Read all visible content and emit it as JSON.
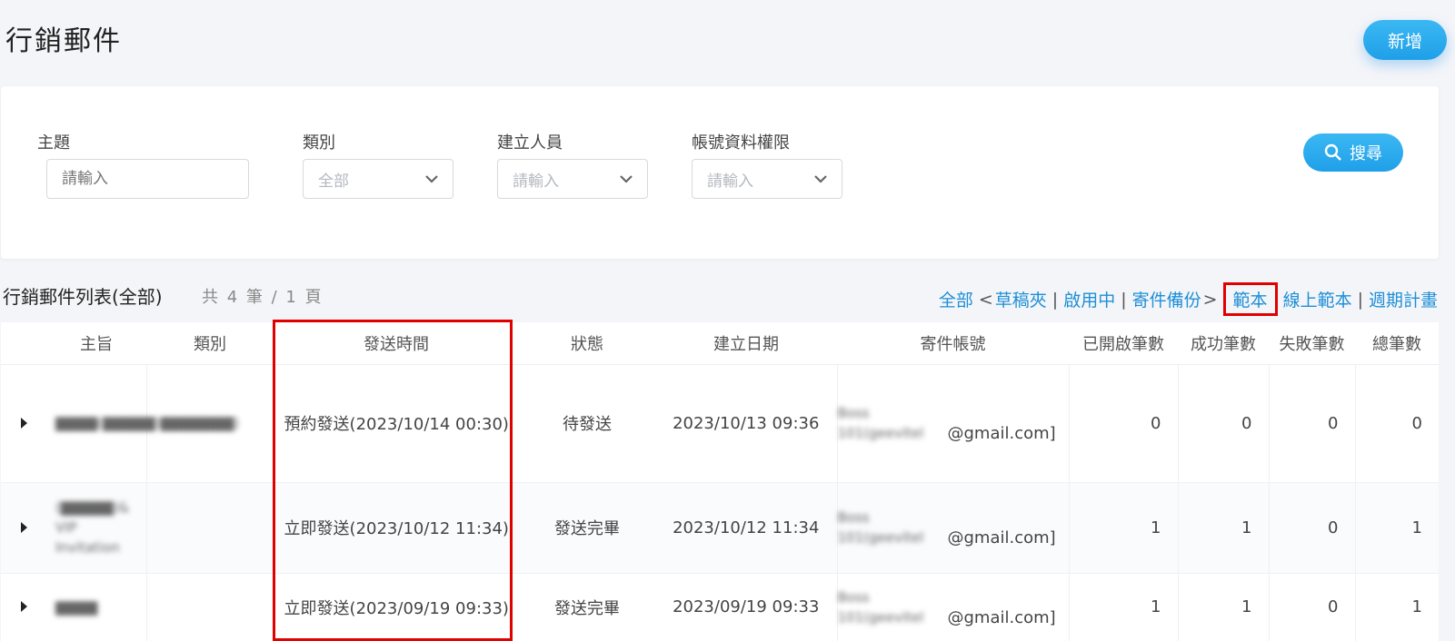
{
  "page": {
    "title": "行銷郵件",
    "add_label": "新增"
  },
  "filters": {
    "subject": {
      "label": "主題",
      "placeholder": "請輸入"
    },
    "category": {
      "label": "類別",
      "value": "全部"
    },
    "creator": {
      "label": "建立人員",
      "value": "請輸入"
    },
    "permission": {
      "label": "帳號資料權限",
      "value": "請輸入"
    },
    "search_label": "搜尋"
  },
  "list": {
    "title": "行銷郵件列表(全部)",
    "count": "共 4 筆 / 1 頁"
  },
  "view_links": {
    "all": "全部",
    "open_bracket": "<",
    "drafts": "草稿夾",
    "active": "啟用中",
    "backup": "寄件備份",
    "close_bracket": ">",
    "templates": "範本",
    "online_templates": "線上範本",
    "scheduled": "週期計畫",
    "separator": "|"
  },
  "table": {
    "headers": [
      "主旨",
      "類別",
      "發送時間",
      "狀態",
      "建立日期",
      "寄件帳號",
      "已開啟筆數",
      "成功筆數",
      "失敗筆數",
      "總筆數"
    ],
    "rows": [
      {
        "subject": "▇▇▇▇(▇▇▇▇▇)▇▇▇▇▇▇▇)",
        "category": "",
        "send_time": "預約發送(2023/10/14 00:30)",
        "status": "待發送",
        "created": "2023/10/13 09:36",
        "sender_blur": "Boss 101(geevitel",
        "sender_suffix": "@gmail.com]",
        "opened": "0",
        "success": "0",
        "failed": "0",
        "total": "0"
      },
      {
        "subject": "(▇▇▇▇▇)& VIP Invitation",
        "category": "",
        "send_time": "立即發送(2023/10/12 11:34)",
        "status": "發送完畢",
        "created": "2023/10/12 11:34",
        "sender_blur": "Boss 101(geevitel",
        "sender_suffix": "@gmail.com]",
        "opened": "1",
        "success": "1",
        "failed": "0",
        "total": "1"
      },
      {
        "subject": "▇▇▇▇",
        "category": "",
        "send_time": "立即發送(2023/09/19 09:33)",
        "status": "發送完畢",
        "created": "2023/09/19 09:33",
        "sender_blur": "Boss 101(geevitel",
        "sender_suffix": "@gmail.com]",
        "opened": "1",
        "success": "1",
        "failed": "0",
        "total": "1"
      }
    ]
  },
  "colors": {
    "accent": "#1f9fe8",
    "highlight": "#e00000",
    "link": "#1e8fd6"
  }
}
